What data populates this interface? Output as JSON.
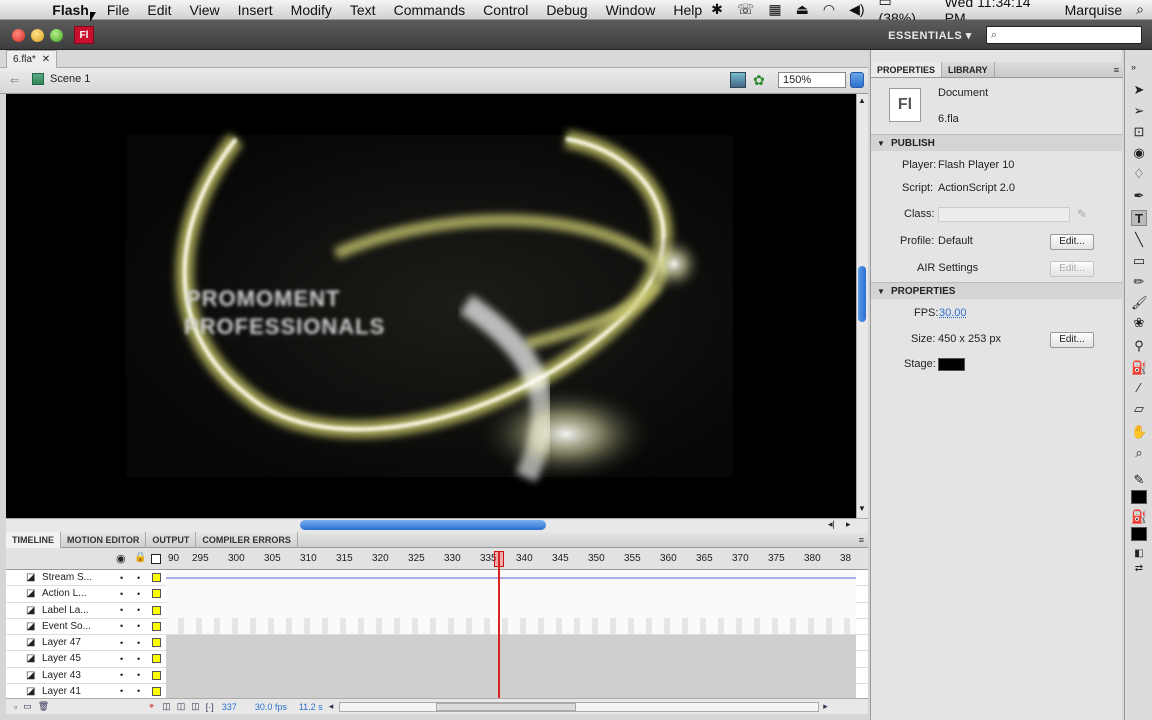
{
  "menubar": {
    "items": [
      "Flash",
      "File",
      "Edit",
      "View",
      "Insert",
      "Modify",
      "Text",
      "Commands",
      "Control",
      "Debug",
      "Window",
      "Help"
    ],
    "battery": "(38%)",
    "clock": "Wed 11:34:14 PM",
    "user": "Marquise"
  },
  "titlebar": {
    "app_badge": "Fl",
    "workspace": "ESSENTIALS ▾"
  },
  "document": {
    "tab_label": "6.fla*",
    "scene": "Scene 1",
    "zoom": "150%"
  },
  "stage": {
    "text_line1": "PROMOMENT",
    "text_line2": "PROFESSIONALS"
  },
  "timeline": {
    "tabs": [
      "TIMELINE",
      "MOTION EDITOR",
      "OUTPUT",
      "COMPILER ERRORS"
    ],
    "frame_ticks": [
      "90",
      "295",
      "300",
      "305",
      "310",
      "315",
      "320",
      "325",
      "330",
      "335",
      "340",
      "345",
      "350",
      "355",
      "360",
      "365",
      "370",
      "375",
      "380",
      "38"
    ],
    "current_frame_marker": "335",
    "layers": [
      "Stream S...",
      "Action L...",
      "Label La...",
      "Event So...",
      "Layer 47",
      "Layer 45",
      "Layer 43",
      "Layer 41"
    ],
    "footer": {
      "frame": "337",
      "fps": "30.0 fps",
      "time": "11.2 s"
    }
  },
  "properties_panel": {
    "tabs": [
      "PROPERTIES",
      "LIBRARY"
    ],
    "doc_icon": "Fl",
    "doc_type": "Document",
    "doc_name": "6.fla",
    "publish_header": "PUBLISH",
    "player_label": "Player:",
    "player_value": "Flash Player 10",
    "script_label": "Script:",
    "script_value": "ActionScript 2.0",
    "class_label": "Class:",
    "profile_label": "Profile:",
    "profile_value": "Default",
    "edit_label": "Edit...",
    "air_label": "AIR Settings",
    "properties_header": "PROPERTIES",
    "fps_label": "FPS:",
    "fps_value": "30.00",
    "size_label": "Size:",
    "size_value": "450 x 253 px",
    "stage_label": "Stage:"
  },
  "colors": {
    "stage_color": "#000000",
    "accent": "#2b6fd0",
    "layer_square": "#ffff00"
  },
  "tools": [
    "selection-icon",
    "subselection-icon",
    "free-transform-icon",
    "3d-rotation-icon",
    "lasso-icon",
    "pen-icon",
    "text-icon",
    "line-icon",
    "rectangle-icon",
    "pencil-icon",
    "brush-icon",
    "deco-icon",
    "bone-icon",
    "paint-bucket-icon",
    "eyedropper-icon",
    "eraser-icon",
    "hand-icon",
    "zoom-icon",
    "stroke-color-icon",
    "fill-color-icon",
    "swap-colors-icon"
  ]
}
